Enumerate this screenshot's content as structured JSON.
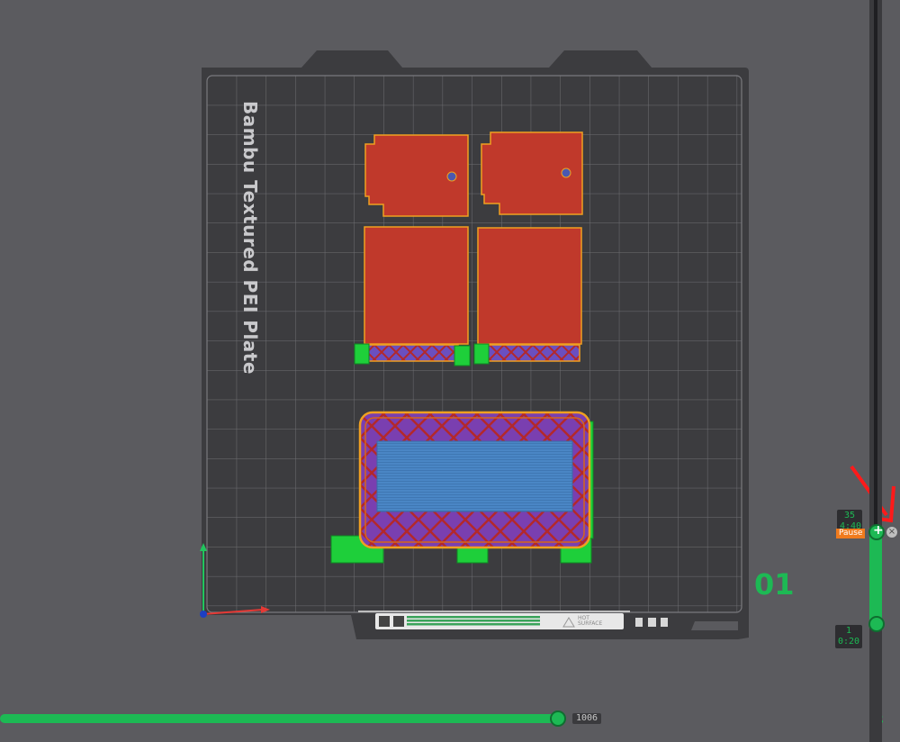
{
  "plate": {
    "label": "Bambu Textured PEI Plate",
    "number": "01",
    "hot_surface_label": "HOT\nSURFACE"
  },
  "layer_slider": {
    "top_layer": "35",
    "top_time": "4:40",
    "pause_label": "Pause",
    "bottom_layer": "1",
    "bottom_time": "0:20",
    "delete_icon": "close-circle-icon",
    "range_fraction": 1.0
  },
  "move_slider": {
    "value": "1006",
    "fraction": 1.0
  },
  "icons": {
    "layers": "layers-icon",
    "annotation_arrow": "red-arrow-icon"
  },
  "colors": {
    "background": "#5b5b5f",
    "plate": "#3f3f42",
    "grid": "#6a6a6e",
    "accent_green": "#1db954",
    "part_red": "#c0392b",
    "infill_purple": "#7a3fb0",
    "top_surface_blue": "#4a86c5",
    "outline_orange": "#f0a020",
    "support_green": "#1ecf3a",
    "pause_orange": "#f07b1d"
  }
}
